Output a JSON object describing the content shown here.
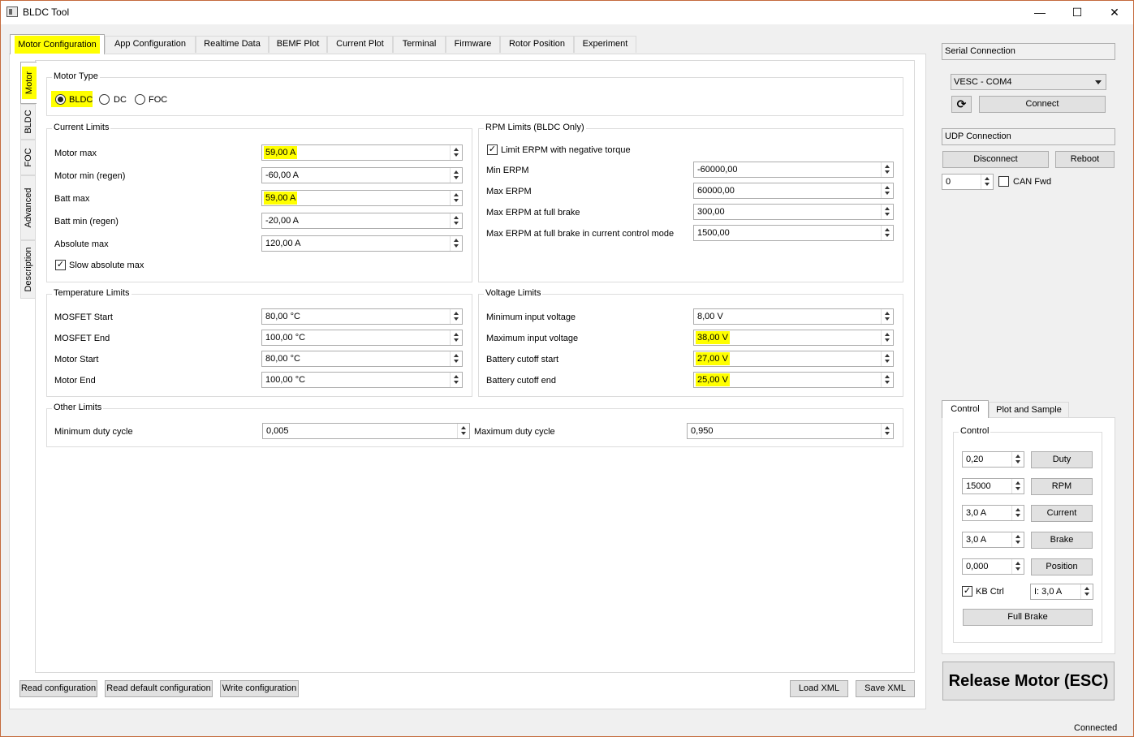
{
  "window": {
    "title": "BLDC Tool",
    "minimize": "—",
    "maximize": "☐",
    "close": "✕"
  },
  "main_tabs": [
    "Motor Configuration",
    "App Configuration",
    "Realtime Data",
    "BEMF Plot",
    "Current Plot",
    "Terminal",
    "Firmware",
    "Rotor Position",
    "Experiment"
  ],
  "side_tabs": [
    "Motor",
    "BLDC",
    "FOC",
    "Advanced",
    "Description"
  ],
  "motor_type": {
    "title": "Motor Type",
    "options": [
      "BLDC",
      "DC",
      "FOC"
    ],
    "selected": "BLDC"
  },
  "current_limits": {
    "title": "Current Limits",
    "rows": [
      {
        "label": "Motor max",
        "value": "59,00 A"
      },
      {
        "label": "Motor min (regen)",
        "value": "-60,00 A"
      },
      {
        "label": "Batt max",
        "value": "59,00 A"
      },
      {
        "label": "Batt min (regen)",
        "value": "-20,00 A"
      },
      {
        "label": "Absolute max",
        "value": "120,00 A"
      }
    ],
    "slow_abs_label": "Slow absolute max"
  },
  "rpm_limits": {
    "title": "RPM Limits (BLDC Only)",
    "limit_label": "Limit ERPM with negative torque",
    "rows": [
      {
        "label": "Min ERPM",
        "value": "-60000,00"
      },
      {
        "label": "Max ERPM",
        "value": "60000,00"
      },
      {
        "label": "Max ERPM at full brake",
        "value": "300,00"
      },
      {
        "label": "Max ERPM at full brake in current control mode",
        "value": "1500,00"
      }
    ]
  },
  "temperature_limits": {
    "title": "Temperature Limits",
    "rows": [
      {
        "label": "MOSFET Start",
        "value": "80,00 °C"
      },
      {
        "label": "MOSFET End",
        "value": "100,00 °C"
      },
      {
        "label": "Motor Start",
        "value": "80,00 °C"
      },
      {
        "label": "Motor End",
        "value": "100,00 °C"
      }
    ]
  },
  "voltage_limits": {
    "title": "Voltage Limits",
    "rows": [
      {
        "label": "Minimum input voltage",
        "value": "8,00 V"
      },
      {
        "label": "Maximum input voltage",
        "value": "38,00 V"
      },
      {
        "label": "Battery cutoff start",
        "value": "27,00 V"
      },
      {
        "label": "Battery cutoff end",
        "value": "25,00 V"
      }
    ]
  },
  "other_limits": {
    "title": "Other Limits",
    "min_duty_label": "Minimum duty cycle",
    "min_duty": "0,005",
    "max_duty_label": "Maximum duty cycle",
    "max_duty": "0,950"
  },
  "bottom_buttons": {
    "read": "Read configuration",
    "read_default": "Read default configuration",
    "write": "Write configuration",
    "load_xml": "Load XML",
    "save_xml": "Save XML"
  },
  "serial": {
    "title": "Serial Connection",
    "port": "VESC - COM4",
    "refresh": "⟳",
    "connect": "Connect"
  },
  "udp": {
    "title": "UDP Connection",
    "disconnect": "Disconnect",
    "reboot": "Reboot",
    "can_id": "0",
    "can_fwd": "CAN Fwd"
  },
  "control_tabs": [
    "Control",
    "Plot and Sample"
  ],
  "control": {
    "title": "Control",
    "rows": [
      {
        "value": "0,20",
        "button": "Duty"
      },
      {
        "value": "15000",
        "button": "RPM"
      },
      {
        "value": "3,0 A",
        "button": "Current"
      },
      {
        "value": "3,0 A",
        "button": "Brake"
      },
      {
        "value": "0,000",
        "button": "Position"
      }
    ],
    "kb_ctrl": "KB Ctrl",
    "kb_current": "I: 3,0 A",
    "full_brake": "Full Brake"
  },
  "release": "Release Motor (ESC)",
  "status": "Connected",
  "highlight_color": "#ffff00"
}
